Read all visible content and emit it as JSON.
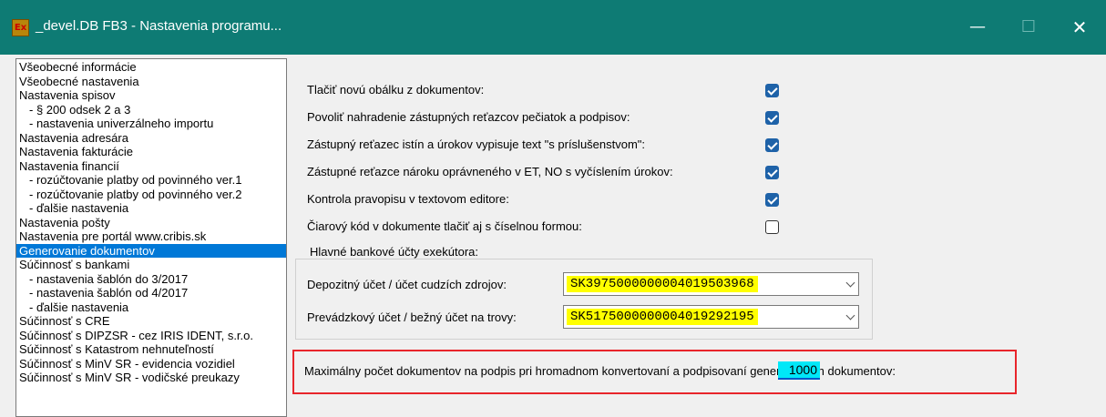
{
  "window": {
    "title": "_devel.DB FB3 - Nastavenia programu...",
    "icon_text": "Ex",
    "minimize_icon": "—",
    "maximize_icon": "☐",
    "close_icon": "✕"
  },
  "nav": [
    {
      "label": "Všeobecné informácie",
      "level": 0
    },
    {
      "label": "Všeobecné nastavenia",
      "level": 0
    },
    {
      "label": "Nastavenia spisov",
      "level": 0
    },
    {
      "label": "- § 200 odsek 2 a 3",
      "level": 1
    },
    {
      "label": "- nastavenia univerzálneho importu",
      "level": 1
    },
    {
      "label": "Nastavenia adresára",
      "level": 0
    },
    {
      "label": "Nastavenia fakturácie",
      "level": 0
    },
    {
      "label": "Nastavenia financií",
      "level": 0
    },
    {
      "label": "- rozúčtovanie platby od povinného ver.1",
      "level": 1
    },
    {
      "label": "- rozúčtovanie platby od povinného ver.2",
      "level": 1
    },
    {
      "label": "- ďalšie nastavenia",
      "level": 1
    },
    {
      "label": "Nastavenia pošty",
      "level": 0
    },
    {
      "label": "Nastavenia pre portál www.cribis.sk",
      "level": 0
    },
    {
      "label": "Generovanie dokumentov",
      "level": 0,
      "selected": true
    },
    {
      "label": "Súčinnosť s bankami",
      "level": 0
    },
    {
      "label": "- nastavenia šablón do 3/2017",
      "level": 1
    },
    {
      "label": "- nastavenia šablón od 4/2017",
      "level": 1
    },
    {
      "label": "- ďalšie nastavenia",
      "level": 1
    },
    {
      "label": "Súčinnosť s CRE",
      "level": 0
    },
    {
      "label": "Súčinnosť s DIPZSR - cez IRIS IDENT, s.r.o.",
      "level": 0
    },
    {
      "label": "Súčinnosť s Katastrom nehnuteľností",
      "level": 0
    },
    {
      "label": "Súčinnosť s MinV SR - evidencia vozidiel",
      "level": 0
    },
    {
      "label": "Súčinnosť s MinV SR - vodičské preukazy",
      "level": 0
    }
  ],
  "settings": [
    {
      "label": "Tlačiť novú obálku z dokumentov:",
      "checked": true
    },
    {
      "label": "Povoliť nahradenie zástupných reťazcov pečiatok a podpisov:",
      "checked": true
    },
    {
      "label": "Zástupný reťazec istín a úrokov vypisuje text \"s príslušenstvom\":",
      "checked": true
    },
    {
      "label": "Zástupné reťazce nároku oprávneného v ET, NO s vyčíslením úrokov:",
      "checked": true
    },
    {
      "label": "Kontrola pravopisu v textovom editore:",
      "checked": true
    },
    {
      "label": "Čiarový kód v dokumente tlačiť aj s číselnou formou:",
      "checked": false
    }
  ],
  "bank_accounts": {
    "title": "Hlavné bankové účty exekútora:",
    "deposit_label": "Depozitný účet / účet cudzích zdrojov:",
    "deposit_value": "SK3975000000004019503968",
    "operating_label": "Prevádzkový účet / bežný účet na trovy:",
    "operating_value": "SK5175000000004019292195"
  },
  "max_docs": {
    "label": "Maximálny počet dokumentov na podpis pri hromadnom konvertovaní a podpisovaní generovaných dokumentov:",
    "value": "1000"
  },
  "colors": {
    "titlebar": "#0e7b74",
    "selection": "#0078d7",
    "checkbox_checked": "#1e62a8",
    "account_highlight": "#ffff00",
    "input_highlight": "#00e8f8",
    "red_frame": "#e8252b"
  }
}
